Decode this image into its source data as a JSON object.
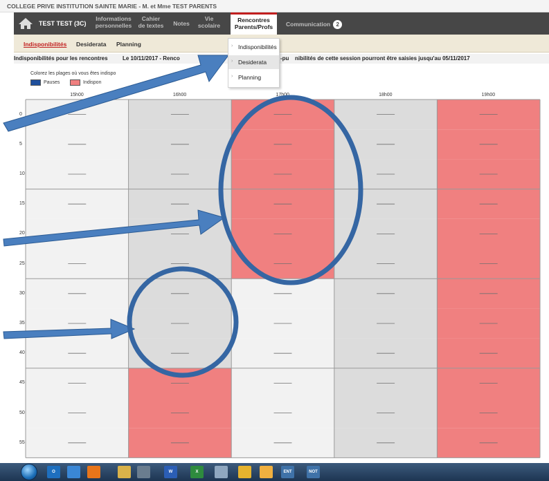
{
  "window": {
    "title": "COLLEGE PRIVE INSTITUTION SAINTE MARIE - M. et Mme TEST PARENTS"
  },
  "navbar": {
    "home_icon": "home-icon",
    "student": "TEST TEST (3C)",
    "items": [
      {
        "line1": "Informations",
        "line2": "personnelles"
      },
      {
        "line1": "Cahier",
        "line2": "de textes"
      },
      {
        "line1": "Notes",
        "line2": ""
      },
      {
        "line1": "Vie",
        "line2": "scolaire"
      },
      {
        "line1": "Rencontres",
        "line2": "Parents/Profs"
      },
      {
        "line1": "Communication",
        "line2": ""
      }
    ],
    "communication_badge": "2",
    "active_color": "#c11f1f"
  },
  "subtabs": {
    "items": [
      "Indisponibilités",
      "Desiderata",
      "Planning"
    ]
  },
  "inforow": {
    "label": "Indisponibilités pour les rencontres",
    "session_prefix": "Le 10/11/2017 - Renco",
    "session_suffix": "-pu",
    "notice": "nibilités de cette session pourront être saisies jusqu'au 05/11/2017"
  },
  "legend": {
    "instruction": "Colorez les plages où vous êtes indispo",
    "items": [
      {
        "label": "Pauses",
        "color": "#1f4f9c"
      },
      {
        "label": "Indispon",
        "color": "#f08080"
      }
    ]
  },
  "dropdown": {
    "items": [
      "Indisponibilités",
      "Desiderata",
      "Planning"
    ],
    "highlighted_index": 1
  },
  "schedule": {
    "columns": [
      "15h00",
      "16h00",
      "17h00",
      "18h00",
      "19h00"
    ],
    "rows": [
      "0",
      "5",
      "10",
      "15",
      "20",
      "25",
      "30",
      "35",
      "40",
      "45",
      "50",
      "55"
    ],
    "unavailable": [
      [
        false,
        false,
        true,
        false,
        true
      ],
      [
        false,
        false,
        true,
        false,
        true
      ],
      [
        false,
        false,
        true,
        false,
        true
      ],
      [
        false,
        false,
        true,
        false,
        true
      ],
      [
        false,
        false,
        true,
        false,
        true
      ],
      [
        false,
        false,
        true,
        false,
        true
      ],
      [
        false,
        false,
        false,
        false,
        true
      ],
      [
        false,
        false,
        false,
        false,
        true
      ],
      [
        false,
        false,
        false,
        false,
        true
      ],
      [
        false,
        true,
        false,
        false,
        true
      ],
      [
        false,
        true,
        false,
        false,
        true
      ],
      [
        false,
        true,
        false,
        false,
        true
      ]
    ],
    "colors": {
      "available_a": "#f2f2f2",
      "available_b": "#dcdcdc",
      "unavailable": "#f08080",
      "grid": "#999999",
      "dash": "#6f6f6f"
    }
  },
  "annotations": {
    "color": "#4a7fbf",
    "outline": "#2a5a93"
  },
  "taskbar": {
    "icons": [
      "outlook-icon",
      "explorer-icon",
      "firefox-icon",
      "folder-icon",
      "network-icon",
      "word-icon",
      "excel-icon",
      "notepad-icon",
      "chrome-icon",
      "chrome-canary-icon",
      "ent-icon",
      "not-icon"
    ],
    "labels": [
      "O",
      "",
      "",
      "",
      "",
      "W",
      "X",
      "",
      "",
      "",
      "ENT",
      "NOT"
    ]
  }
}
